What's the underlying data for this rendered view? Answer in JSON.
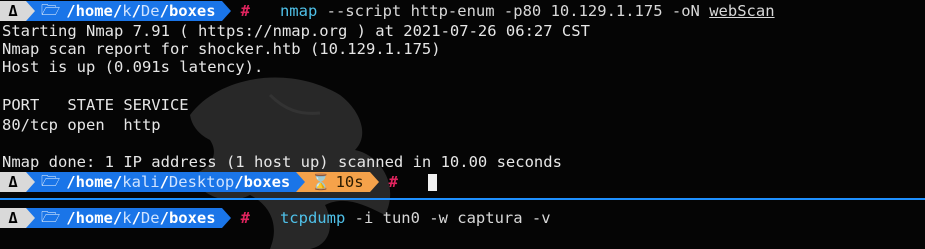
{
  "prompt": {
    "os_icon": "linux-penguin-icon",
    "folder_icon": "folder-icon",
    "timer_icon": "hourglass-icon",
    "hash": "#",
    "colors": {
      "os_segment": "#d9d9d9",
      "path_segment": "#1a75e8",
      "timer_segment": "#f5a24a",
      "hash": "#e0245e",
      "command_exe": "#4fc1e9",
      "divider": "#1e90ff"
    }
  },
  "top_pane": {
    "prompt1": {
      "path_prefix": "/home/",
      "path_user": "k",
      "path_sep": "/",
      "path_mid": "De",
      "path_sep2": "/",
      "path_last": "boxes",
      "command_exe": "nmap",
      "command_args": " --script http-enum -p80 10.129.1.175 -oN ",
      "command_file": "webScan"
    },
    "output": [
      "Starting Nmap 7.91 ( https://nmap.org ) at 2021-07-26 06:27 CST",
      "Nmap scan report for shocker.htb (10.129.1.175)",
      "Host is up (0.091s latency).",
      "",
      "PORT   STATE SERVICE",
      "80/tcp open  http",
      "",
      "Nmap done: 1 IP address (1 host up) scanned in 10.00 seconds"
    ],
    "prompt2": {
      "path_prefix": "/home/",
      "path_user": "kali",
      "path_sep": "/",
      "path_mid": "Desktop",
      "path_sep2": "/",
      "path_last": "boxes",
      "timer": "10s"
    }
  },
  "bottom_pane": {
    "prompt": {
      "path_prefix": "/home/",
      "path_user": "k",
      "path_sep": "/",
      "path_mid": "De",
      "path_sep2": "/",
      "path_last": "boxes",
      "command_exe": "tcpdump",
      "command_args": " -i tun0 -w captura -v"
    }
  }
}
